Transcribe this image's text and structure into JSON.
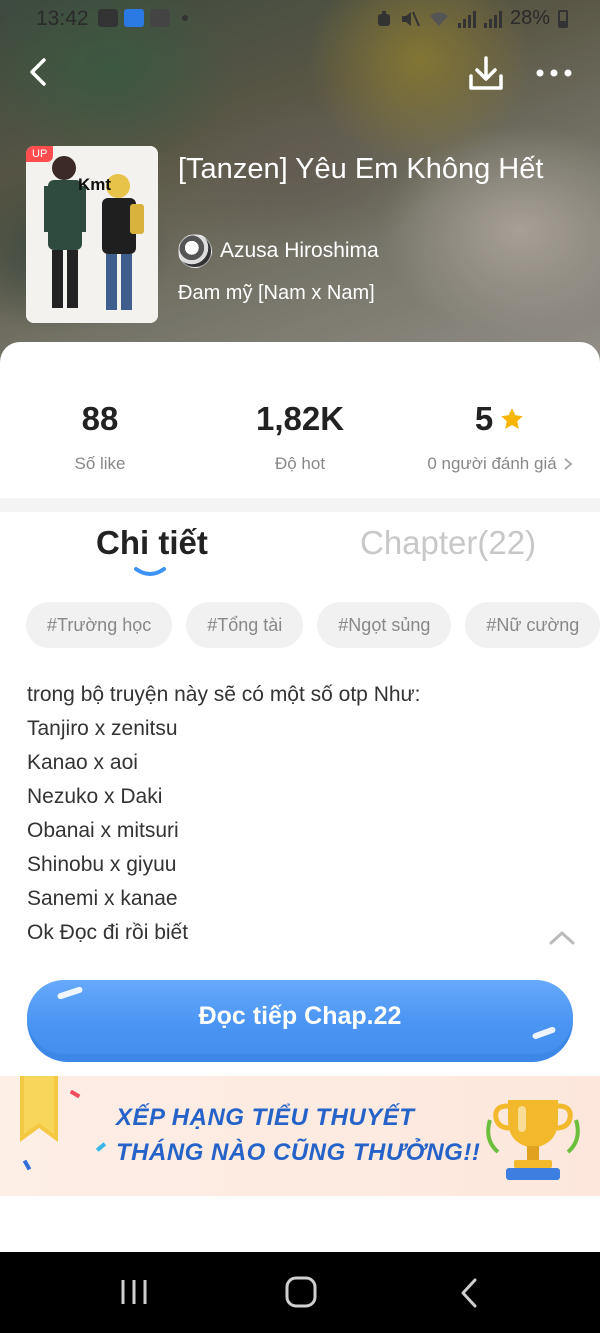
{
  "status_bar": {
    "time": "13:42",
    "battery": "28%"
  },
  "header": {
    "back_icon": "chevron-left-icon",
    "download_icon": "download-icon",
    "more_icon": "more-dots-icon"
  },
  "book": {
    "badge": "UP",
    "cover_text": "Kmt",
    "title": "[Tanzen] Yêu Em Không Hết",
    "author": "Azusa Hiroshima",
    "genre": "Đam mỹ [Nam x Nam]"
  },
  "stats": {
    "likes_value": "88",
    "likes_label": "Số like",
    "hot_value": "1,82K",
    "hot_label": "Độ hot",
    "rating_value": "5",
    "rating_label": "0 người đánh giá"
  },
  "tabs": {
    "detail": "Chi tiết",
    "chapter": "Chapter(22)"
  },
  "tags": [
    "#Trường học",
    "#Tổng tài",
    "#Ngọt sủng",
    "#Nữ cường"
  ],
  "description": [
    "trong bộ truyện này sẽ có một số otp Như:",
    "Tanjiro x zenitsu",
    "Kanao x aoi",
    "Nezuko x Daki",
    "Obanai x mitsuri",
    "Shinobu x giyuu",
    "Sanemi x kanae",
    "Ok Đọc đi rồi biết"
  ],
  "read_button": "Đọc tiếp Chap.22",
  "banner": {
    "line1": "XẾP HẠNG TIỂU THUYẾT",
    "line2": "THÁNG NÀO CŨNG THƯỞNG!!"
  },
  "colors": {
    "accent": "#4a94f3",
    "star": "#f7b500",
    "badge": "#ff4d4f",
    "banner_text": "#2663c9"
  }
}
